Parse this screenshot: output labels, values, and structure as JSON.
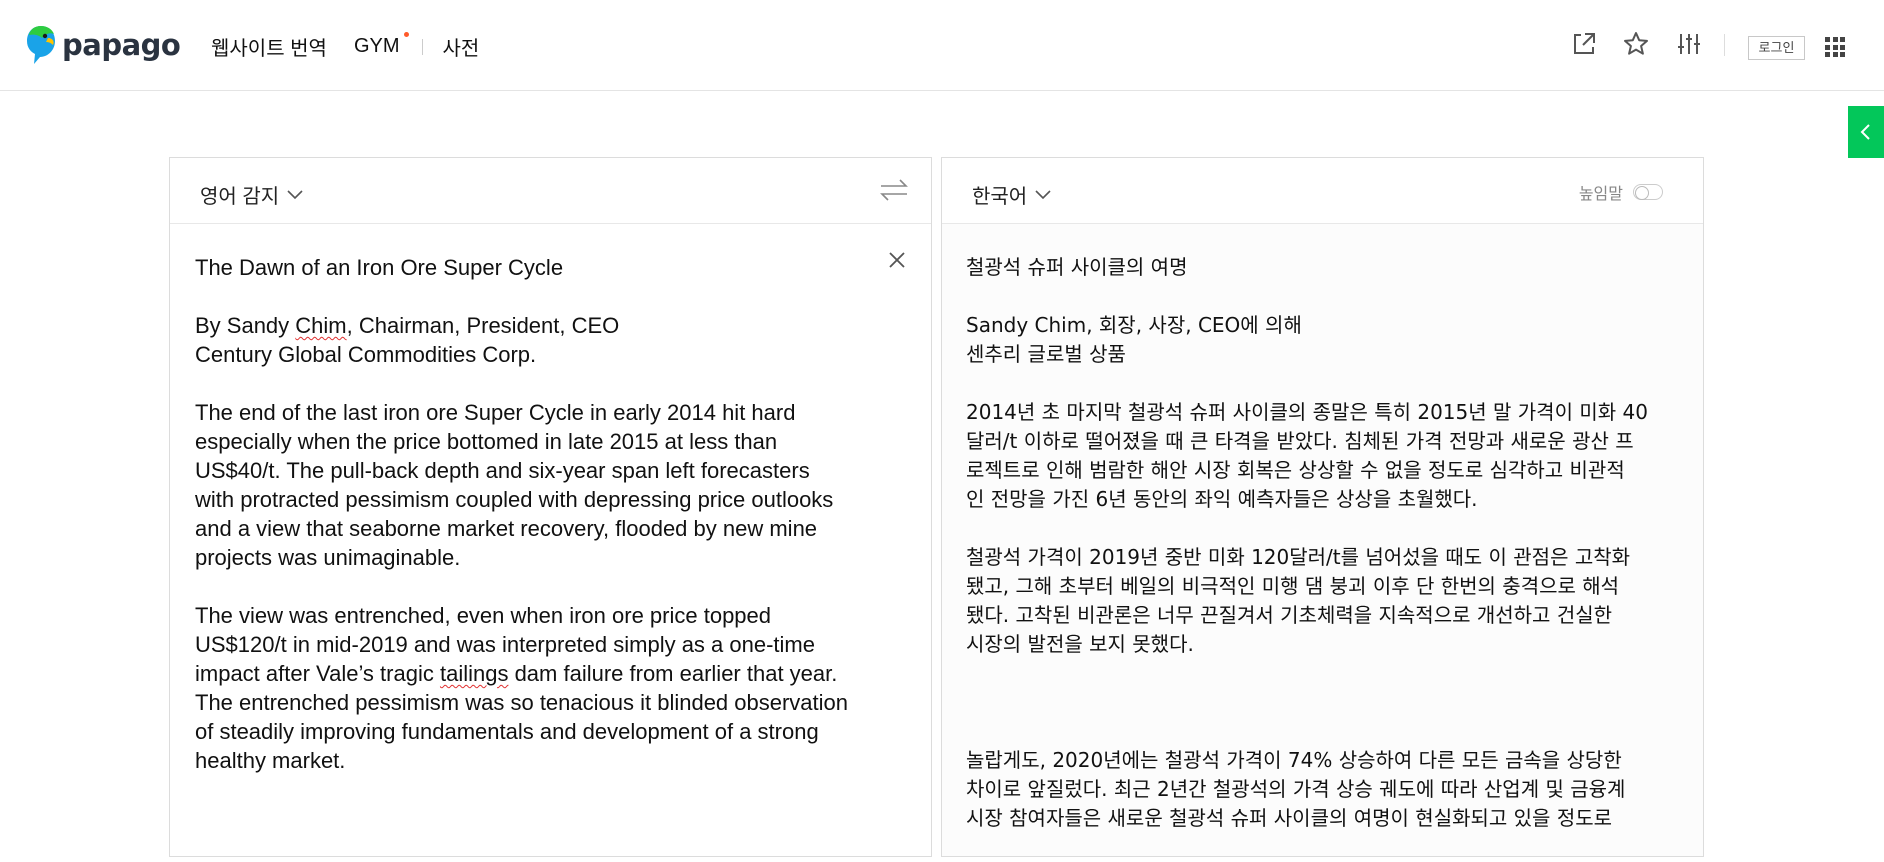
{
  "header": {
    "logo_text": "papago",
    "nav": [
      {
        "label": "웹사이트 번역"
      },
      {
        "label": "GYM"
      },
      {
        "label": "사전"
      }
    ],
    "login_label": "로그인"
  },
  "source": {
    "language": "영어 감지",
    "paragraphs": [
      "The Dawn of an Iron Ore Super Cycle",
      "By Sandy Chim, Chairman, President, CEO\nCentury Global Commodities Corp.",
      "The end of the last iron ore Super Cycle in early 2014 hit hard\nespecially when the price bottomed in late 2015 at less than\nUS$40/t.  The pull-back depth and six-year span left forecasters\nwith protracted pessimism coupled with depressing price outlooks\nand a view that seaborne market recovery, flooded by new mine\nprojects was unimaginable.",
      "The view was entrenched, even when iron ore price topped\nUS$120/t in mid-2019 and was interpreted simply as a one-time\nimpact after Vale’s tragic tailings dam failure from earlier that year.\nThe entrenched pessimism was so tenacious it blinded observation\nof steadily improving fundamentals and development of a strong\nhealthy market."
    ]
  },
  "target": {
    "language": "한국어",
    "honorific_label": "높임말",
    "paragraphs": [
      "철광석 슈퍼 사이클의 여명",
      "Sandy Chim, 회장, 사장, CEO에 의해\n센추리 글로벌 상품",
      "2014년 초 마지막 철광석 슈퍼 사이클의 종말은 특히 2015년 말 가격이 미화 40\n달러/t 이하로 떨어졌을 때 큰 타격을 받았다. 침체된 가격 전망과 새로운 광산 프\n로젝트로 인해 범람한 해안 시장 회복은 상상할 수 없을 정도로 심각하고 비관적\n인 전망을 가진 6년 동안의 좌익 예측자들은 상상을 초월했다.",
      "철광석 가격이 2019년 중반 미화 120달러/t를 넘어섰을 때도 이 관점은 고착화\n됐고, 그해 초부터 베일의 비극적인 미행 댐 붕괴 이후 단 한번의 충격으로 해석\n됐다. 고착된 비관론은 너무 끈질겨서 기초체력을 지속적으로 개선하고 건실한\n시장의 발전을 보지 못했다.",
      "놀랍게도, 2020년에는 철광석 가격이 74% 상승하여 다른 모든 금속을 상당한\n차이로 앞질렀다. 최근 2년간 철광석의 가격 상승 궤도에 따라 산업계 및 금융계\n시장 참여자들은 새로운 철광석 슈퍼 사이클의 여명이 현실화되고 있을 정도로"
    ]
  },
  "colors": {
    "brand_green": "#03c75a",
    "nav_dot": "#ff5a2a"
  }
}
